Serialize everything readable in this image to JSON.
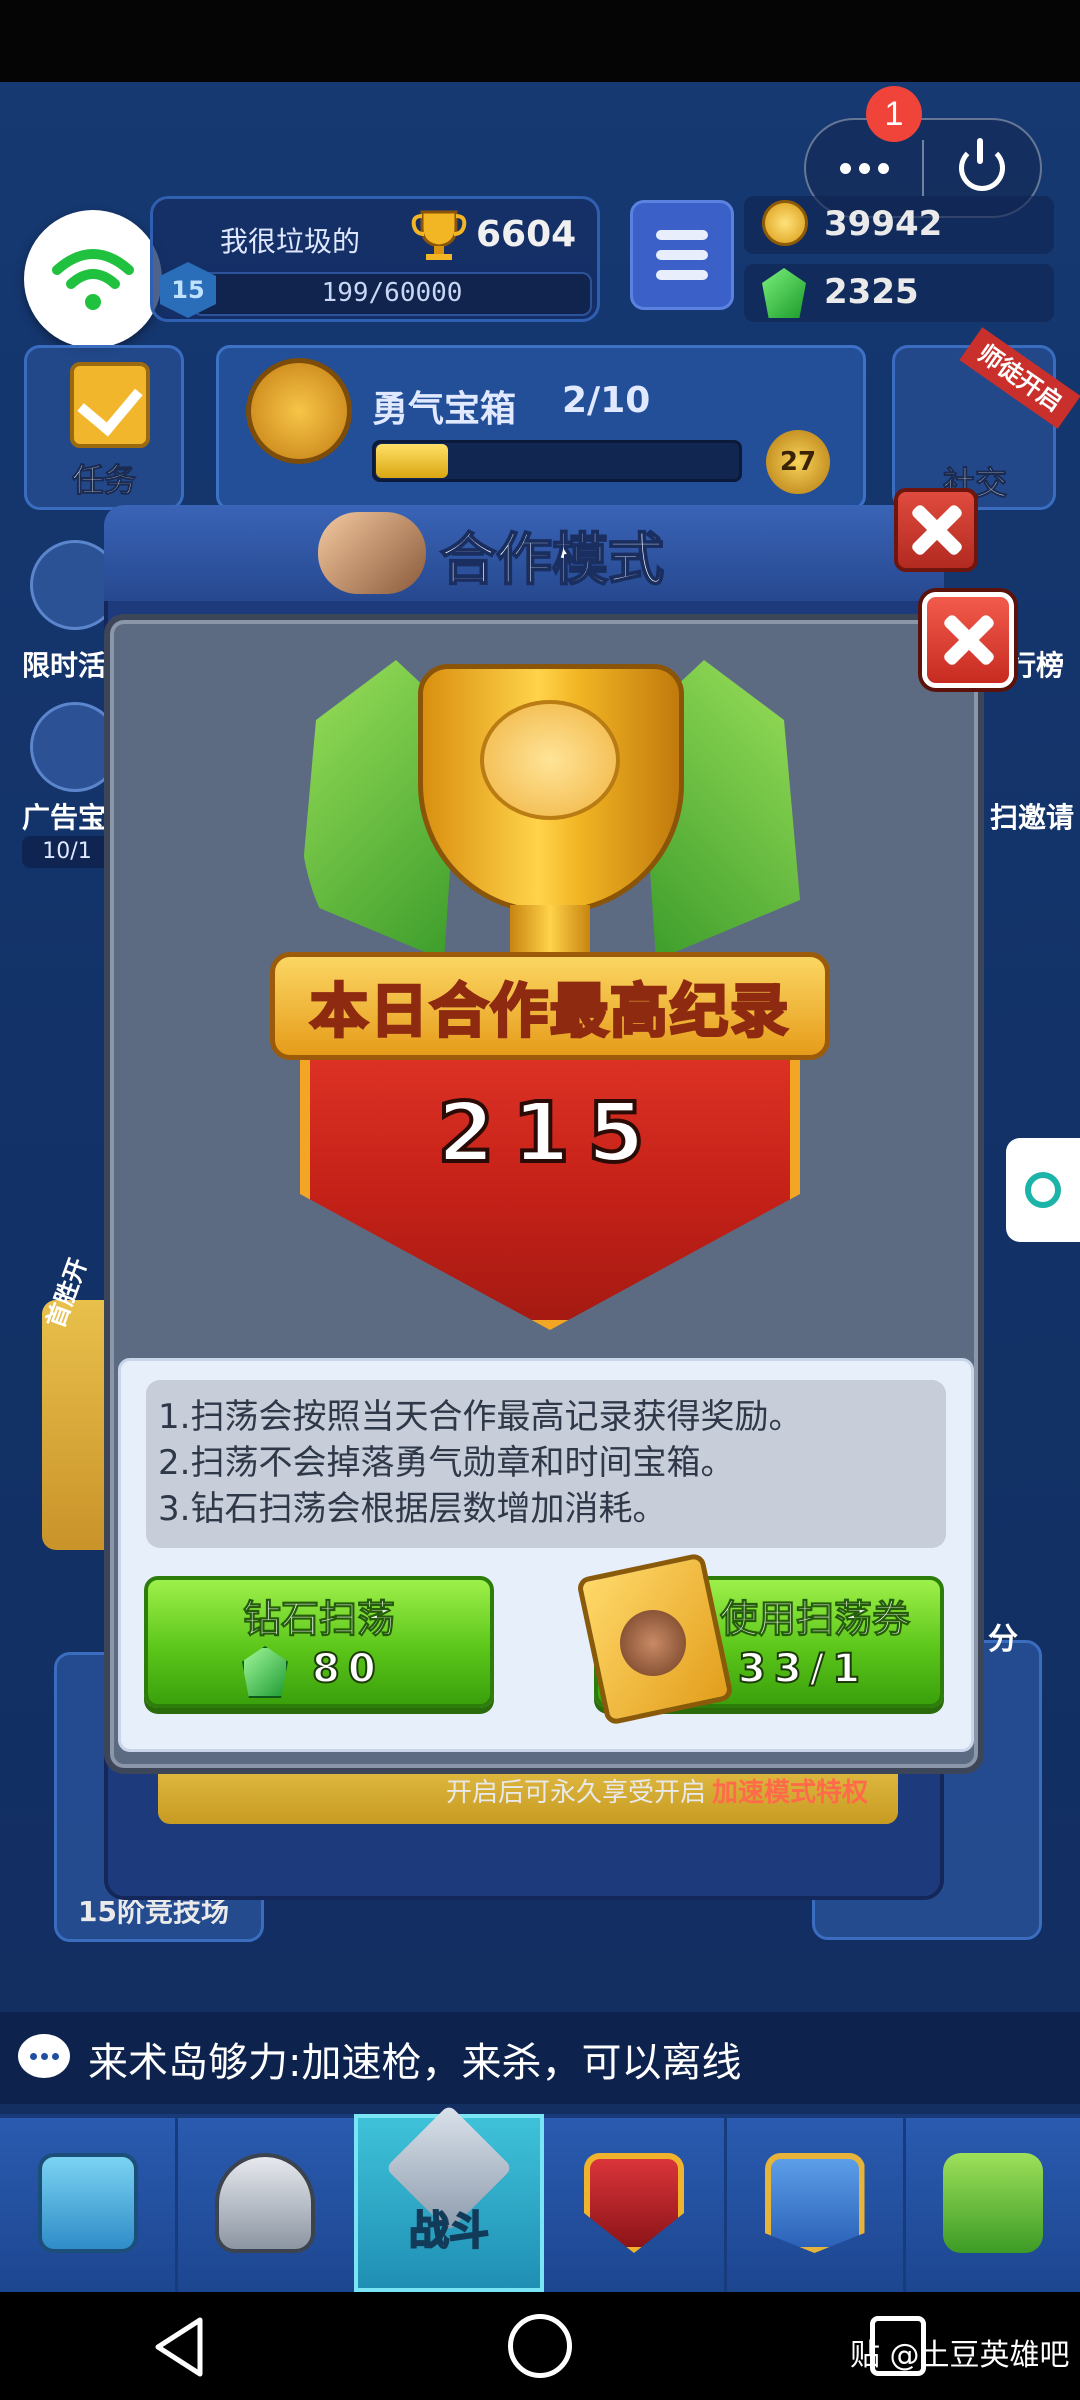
{
  "capsule": {
    "notification_count": "1"
  },
  "player": {
    "name": "我很垃圾的",
    "trophies": "6604",
    "level": "15",
    "xp": "199/60000"
  },
  "currency": {
    "gold": "39942",
    "gems": "2325"
  },
  "task": {
    "label": "任务"
  },
  "courage_chest": {
    "title": "勇气宝箱",
    "progress": "2/10",
    "badge": "27",
    "progress_fraction": 0.2
  },
  "social": {
    "label": "社交",
    "ribbon": "师徒开启"
  },
  "left_side": {
    "limited_label": "限时活",
    "ad_label": "广告宝",
    "ad_count": "10/1"
  },
  "right_side": {
    "rank_label": "行榜",
    "invite_label": "扫邀请"
  },
  "coop": {
    "title": "合作模式",
    "footer_text": "开启后可永久享受开启",
    "footer_red": "加速模式特权",
    "left_card_label": "15阶竞技场",
    "right_score": "分",
    "left_banner": "首胜开"
  },
  "popup": {
    "banner": "本日合作最高纪录",
    "record": "215",
    "rules": [
      "1.扫荡会按照当天合作最高记录获得奖励。",
      "2.扫荡不会掉落勇气勋章和时间宝箱。",
      "3.钻石扫荡会根据层数增加消耗。"
    ],
    "diamond_sweep": {
      "label": "钻石扫荡",
      "cost": "80"
    },
    "ticket_sweep": {
      "label": "使用扫荡券",
      "count": "33/1"
    }
  },
  "chat": {
    "text": "来术岛够力:加速枪，来杀，可以离线"
  },
  "nav": {
    "battle_label": "战斗",
    "items": [
      "chest",
      "knight",
      "battle",
      "clan",
      "social",
      "island"
    ]
  },
  "watermark": "贴 @土豆英雄吧",
  "colors": {
    "game_bg": "#1f4f9e",
    "popup_bg": "#5d6b82",
    "green_button": "#5cc61a",
    "red_close": "#c72b20",
    "shield_red": "#c52118",
    "gold": "#f2a623"
  }
}
